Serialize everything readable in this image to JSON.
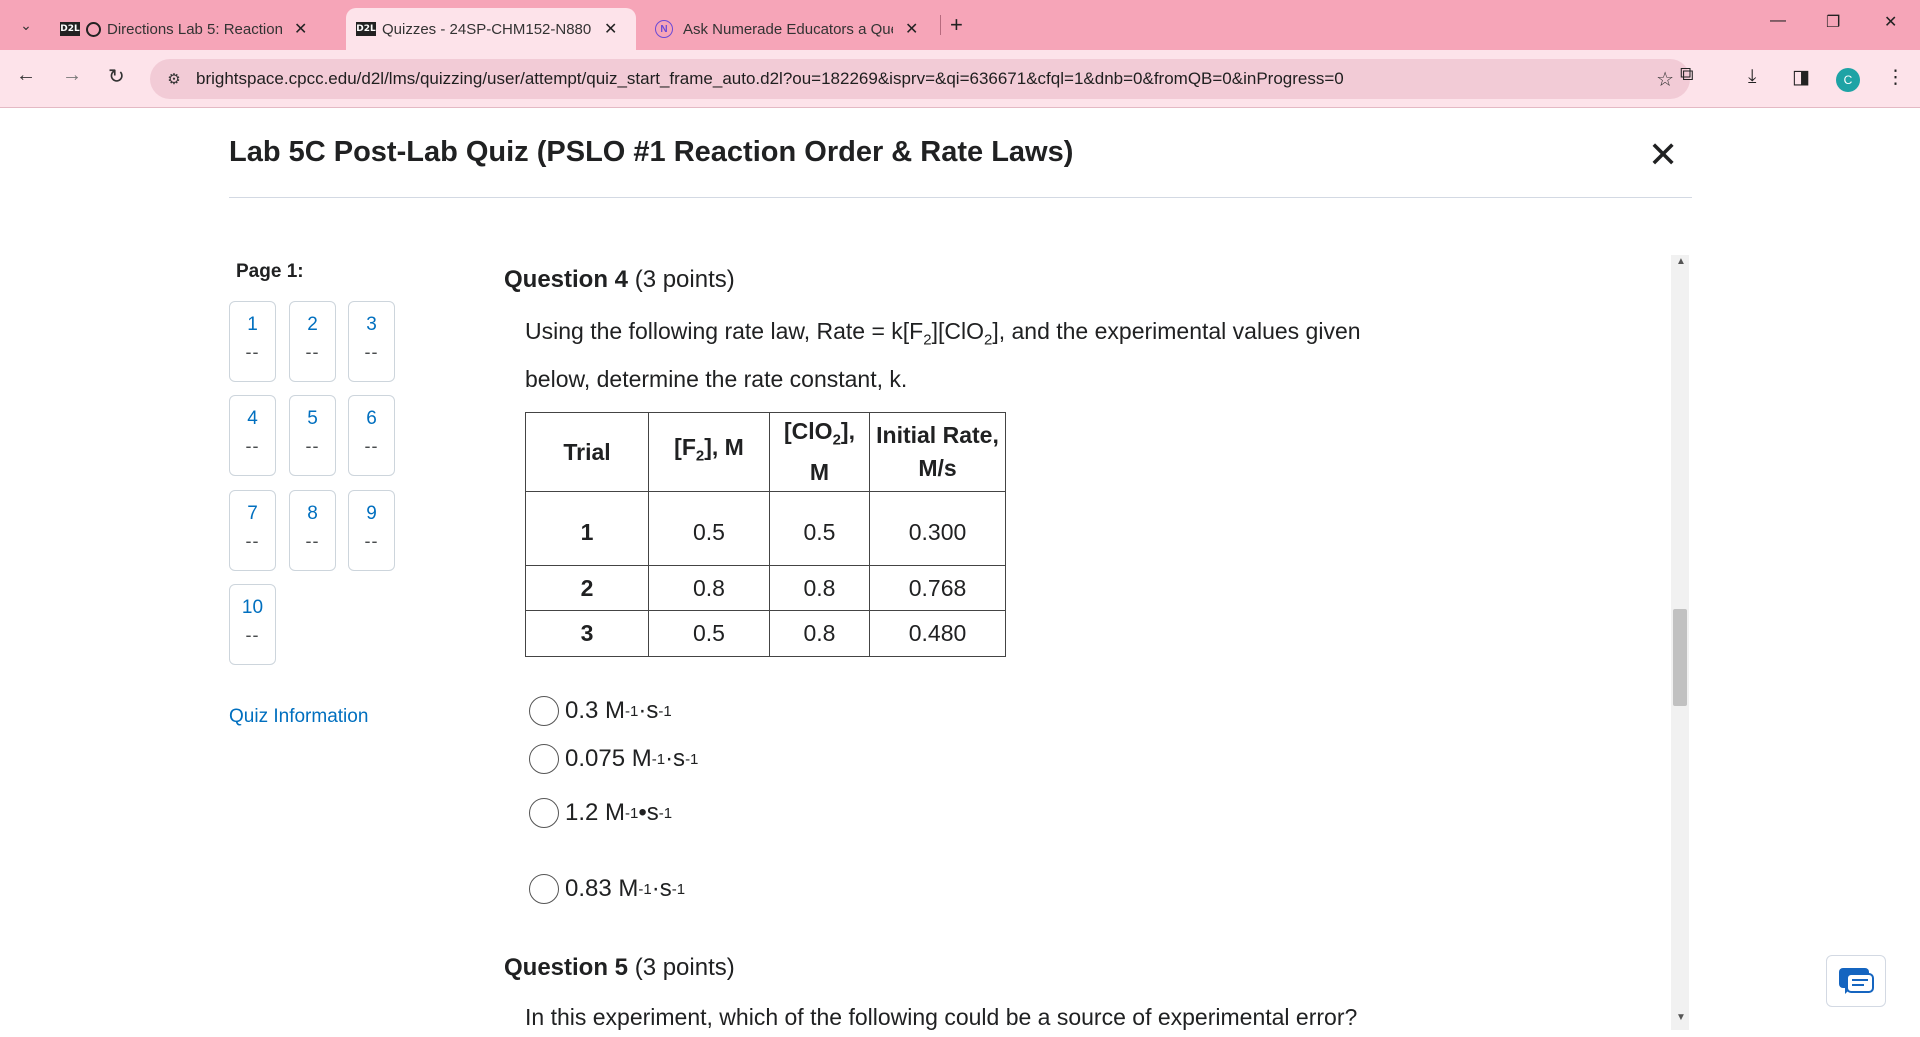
{
  "browser": {
    "tabs": [
      {
        "favicon": "D2L",
        "title": "Directions Lab 5: Reaction C",
        "active": false
      },
      {
        "favicon": "D2L",
        "title": "Quizzes - 24SP-CHM152-N880",
        "active": true
      },
      {
        "favicon": "N",
        "title": "Ask Numerade Educators a Que",
        "active": false
      }
    ],
    "url": "brightspace.cpcc.edu/d2l/lms/quizzing/user/attempt/quiz_start_frame_auto.d2l?ou=182269&isprv=&qi=636671&cfql=1&dnb=0&fromQB=0&inProgress=0",
    "profile_initial": "C",
    "accent_color": "#f6a5b8"
  },
  "quiz": {
    "title": "Lab 5C Post-Lab Quiz (PSLO #1 Reaction Order & Rate Laws)",
    "page_label": "Page 1:",
    "question_nav": [
      "1",
      "2",
      "3",
      "4",
      "5",
      "6",
      "7",
      "8",
      "9",
      "10"
    ],
    "nav_status": "--",
    "info_link": "Quiz Information"
  },
  "question4": {
    "number": "Question 4",
    "points": "(3 points)",
    "text_a": "Using the following rate law, Rate = k[F",
    "sub_a": "2",
    "text_b": "][ClO",
    "sub_b": "2",
    "text_c": "], and the experimental values given below, determine the rate constant, k.",
    "table": {
      "headers": [
        "Trial",
        "[F2], M",
        "[ClO2], M",
        "Initial Rate, M/s"
      ],
      "rows": [
        [
          "1",
          "0.5",
          "0.5",
          "0.300"
        ],
        [
          "2",
          "0.8",
          "0.8",
          "0.768"
        ],
        [
          "3",
          "0.5",
          "0.8",
          "0.480"
        ]
      ]
    },
    "options": [
      {
        "value": "0.3 M",
        "exp1": "-1",
        "sep": "·s",
        "exp2": "-1"
      },
      {
        "value": "0.075 M",
        "exp1": "-1",
        "sep": "·s",
        "exp2": "-1"
      },
      {
        "value": "1.2 M",
        "exp1": "-1",
        "sep": "•s",
        "exp2": "-1"
      },
      {
        "value": "0.83 M",
        "exp1": "-1",
        "sep": "·s",
        "exp2": "-1"
      }
    ]
  },
  "question5": {
    "number": "Question 5",
    "points": "(3 points)",
    "text": "In this experiment, which of the following could be a source of experimental error?"
  }
}
